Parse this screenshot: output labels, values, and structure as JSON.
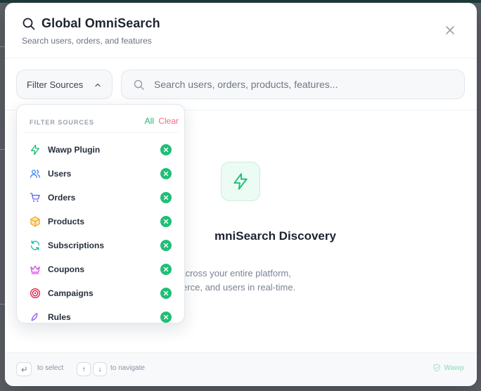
{
  "modal": {
    "title": "Global OmniSearch",
    "subtitle": "Search users, orders, and features",
    "close_icon": "close-icon"
  },
  "toolbar": {
    "filter_label": "Filter Sources",
    "search_placeholder": "Search users, orders, products, features...",
    "search_value": ""
  },
  "empty_state": {
    "title": "OmniSearch Discovery",
    "visible_title": "mniSearch Discovery",
    "desc_line1": "ch across your entire platform,",
    "desc_line2": "nmerce, and users in real-time.",
    "icon": "bolt-icon"
  },
  "dropdown": {
    "heading": "FILTER SOURCES",
    "all_label": "All",
    "clear_label": "Clear",
    "items": [
      {
        "label": "Wawp Plugin",
        "icon": "bolt-icon",
        "color": "#1fbf76",
        "selected": true
      },
      {
        "label": "Users",
        "icon": "users-icon",
        "color": "#3b82f6",
        "selected": true
      },
      {
        "label": "Orders",
        "icon": "cart-icon",
        "color": "#6366f1",
        "selected": true
      },
      {
        "label": "Products",
        "icon": "box-icon",
        "color": "#f5a524",
        "selected": true
      },
      {
        "label": "Subscriptions",
        "icon": "refresh-icon",
        "color": "#14b8a6",
        "selected": true
      },
      {
        "label": "Coupons",
        "icon": "crown-icon",
        "color": "#d946ef",
        "selected": true
      },
      {
        "label": "Campaigns",
        "icon": "target-icon",
        "color": "#e11d48",
        "selected": true
      },
      {
        "label": "Rules",
        "icon": "rocket-icon",
        "color": "#8b5cf6",
        "selected": true
      }
    ]
  },
  "footer": {
    "select_key": "↵",
    "select_text": "to select",
    "up_key": "↑",
    "down_key": "↓",
    "navigate_text": "to navigate",
    "brand": "Wawp",
    "brand_icon": "shield-check-icon"
  },
  "colors": {
    "accent_green": "#1fbf76",
    "clear_pink": "#f06a87",
    "title_text": "#1d2330"
  }
}
